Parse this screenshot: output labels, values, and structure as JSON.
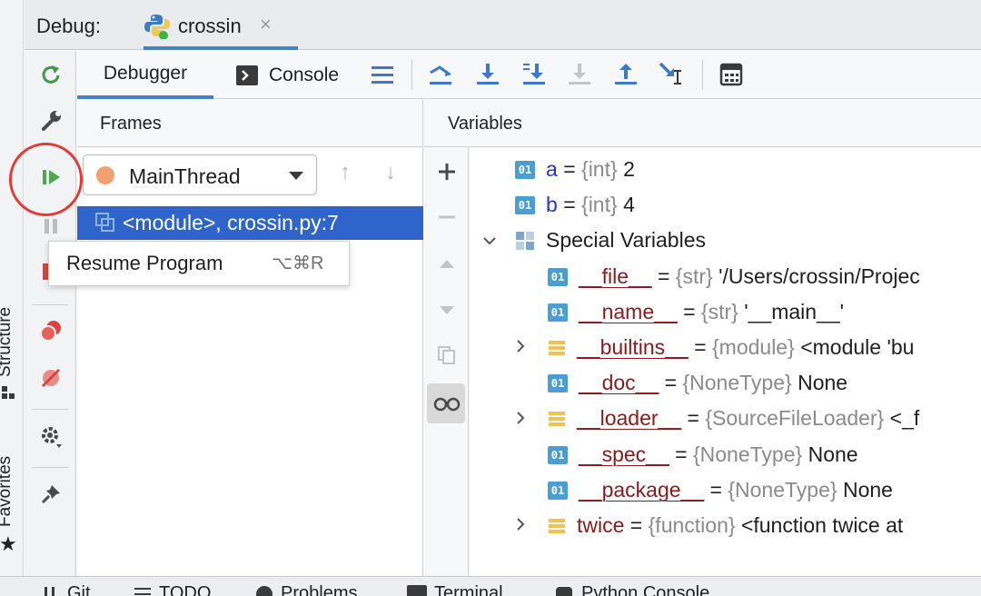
{
  "debug_header": {
    "title": "Debug:",
    "run_tab_label": "crossin",
    "run_tab_close": "×"
  },
  "left_strip": {
    "structure_label": "Structure",
    "favorites_label": "Favorites",
    "favorites_icon": "★"
  },
  "tabs": {
    "debugger": "Debugger",
    "console": "Console"
  },
  "toolbar_icons": [
    "menu-icon",
    "show-execution-point-icon",
    "step-over-icon",
    "step-into-icon",
    "step-into-my-code-icon",
    "force-step-into-icon",
    "step-out-icon",
    "run-to-cursor-icon",
    "evaluate-expression-icon"
  ],
  "frames": {
    "title": "Frames",
    "thread": "MainThread",
    "thread_color": "#f3a070",
    "up_arrow": "↑",
    "down_arrow": "↓",
    "selected_frame": "<module>, crossin.py:7"
  },
  "tooltip": {
    "text": "Resume Program",
    "shortcut": "⌥⌘R"
  },
  "variables": {
    "title": "Variables",
    "rows": [
      {
        "name": "a",
        "eq": "=",
        "type": "{int}",
        "value": "2"
      },
      {
        "name": "b",
        "eq": "=",
        "type": "{int}",
        "value": "4"
      },
      {
        "name": "Special Variables"
      },
      {
        "name": "__file__",
        "eq": "=",
        "type": "{str}",
        "value": "'/Users/crossin/Projec"
      },
      {
        "name": "__name__",
        "eq": "=",
        "type": "{str}",
        "value": "'__main__'"
      },
      {
        "name": "__builtins__",
        "eq": "=",
        "type": "{module}",
        "value": "<module 'bu"
      },
      {
        "name": "__doc__",
        "eq": "=",
        "type": "{NoneType}",
        "value": "None"
      },
      {
        "name": "__loader__",
        "eq": "=",
        "type": "{SourceFileLoader}",
        "value": "<_f"
      },
      {
        "name": "__spec__",
        "eq": "=",
        "type": "{NoneType}",
        "value": "None"
      },
      {
        "name": "__package__",
        "eq": "=",
        "type": "{NoneType}",
        "value": "None"
      },
      {
        "name": "twice",
        "eq": "=",
        "type": "{function}",
        "value": "<function twice at"
      }
    ]
  },
  "bottom_bar": {
    "items": [
      "Git",
      "TODO",
      "Problems",
      "Terminal",
      "Python Console"
    ]
  },
  "colors": {
    "accent_blue": "#4083c9",
    "selection_blue": "#2f65ca",
    "resume_green": "#4fa64f",
    "highlight_red": "#e53935"
  }
}
